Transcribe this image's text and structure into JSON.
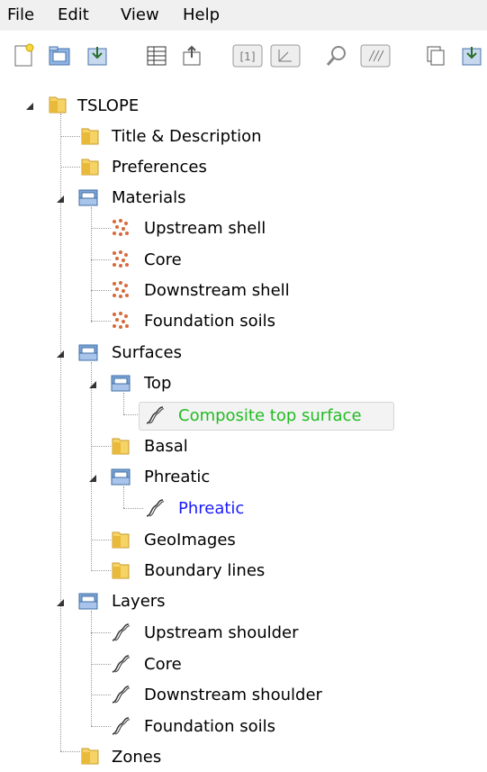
{
  "menu": {
    "file": "File",
    "edit": "Edit",
    "view": "View",
    "help": "Help"
  },
  "tree": {
    "root": "TSLOPE",
    "title_desc": "Title & Description",
    "preferences": "Preferences",
    "materials": "Materials",
    "mat_upstream": "Upstream shell",
    "mat_core": "Core",
    "mat_downstream": "Downstream shell",
    "mat_foundation": "Foundation soils",
    "surfaces": "Surfaces",
    "top": "Top",
    "composite": "Composite top surface",
    "basal": "Basal",
    "phreatic_folder": "Phreatic",
    "phreatic_item": "Phreatic",
    "geoimages": "GeoImages",
    "boundary": "Boundary lines",
    "layers": "Layers",
    "lay_upstream": "Upstream shoulder",
    "lay_core": "Core",
    "lay_downstream": "Downstream shoulder",
    "lay_foundation": "Foundation soils",
    "zones": "Zones"
  },
  "colors": {
    "selected_text": "#22bb22",
    "link_text": "#1a1aff"
  }
}
